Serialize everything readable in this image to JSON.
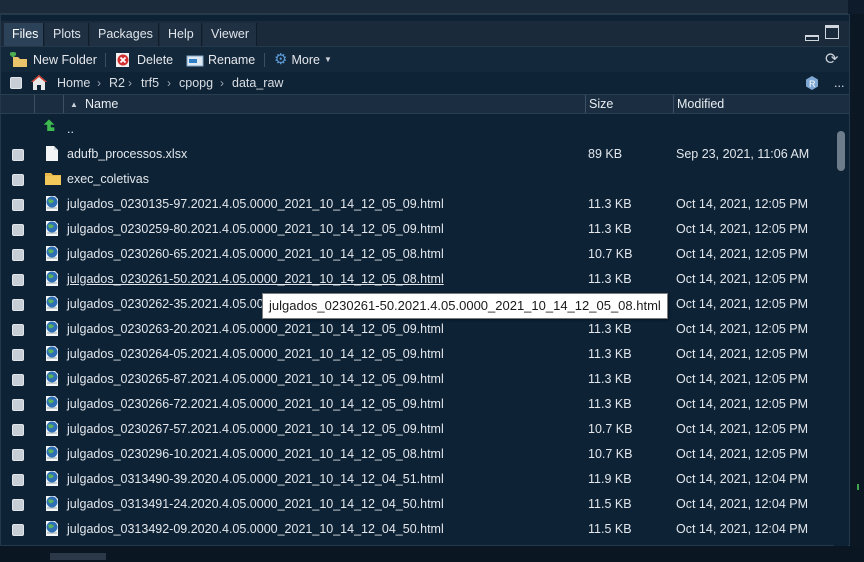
{
  "tabs": [
    {
      "label": "Files",
      "active": true
    },
    {
      "label": "Plots",
      "active": false
    },
    {
      "label": "Packages",
      "active": false
    },
    {
      "label": "Help",
      "active": false
    },
    {
      "label": "Viewer",
      "active": false
    }
  ],
  "toolbar": {
    "new_folder": "New Folder",
    "delete": "Delete",
    "rename": "Rename",
    "more": "More"
  },
  "breadcrumb": [
    "Home",
    "R2",
    "trf5",
    "cpopg",
    "data_raw"
  ],
  "breadcrumb_more": "...",
  "columns": {
    "name": "Name",
    "size": "Size",
    "modified": "Modified"
  },
  "up_label": "..",
  "files": [
    {
      "type": "file",
      "name": "adufb_processos.xlsx",
      "size": "89 KB",
      "modified": "Sep 23, 2021, 11:06 AM"
    },
    {
      "type": "folder",
      "name": "exec_coletivas",
      "size": "",
      "modified": ""
    },
    {
      "type": "html",
      "name": "julgados_0230135-97.2021.4.05.0000_2021_10_14_12_05_09.html",
      "size": "11.3 KB",
      "modified": "Oct 14, 2021, 12:05 PM"
    },
    {
      "type": "html",
      "name": "julgados_0230259-80.2021.4.05.0000_2021_10_14_12_05_09.html",
      "size": "11.3 KB",
      "modified": "Oct 14, 2021, 12:05 PM"
    },
    {
      "type": "html",
      "name": "julgados_0230260-65.2021.4.05.0000_2021_10_14_12_05_08.html",
      "size": "10.7 KB",
      "modified": "Oct 14, 2021, 12:05 PM"
    },
    {
      "type": "html",
      "name": "julgados_0230261-50.2021.4.05.0000_2021_10_14_12_05_08.html",
      "size": "11.3 KB",
      "modified": "Oct 14, 2021, 12:05 PM",
      "hover": true
    },
    {
      "type": "html",
      "name": "julgados_0230262-35.2021.4.05.0000_2021_10_14_12_05_09.html",
      "size": "",
      "modified": "Oct 14, 2021, 12:05 PM"
    },
    {
      "type": "html",
      "name": "julgados_0230263-20.2021.4.05.0000_2021_10_14_12_05_09.html",
      "size": "11.3 KB",
      "modified": "Oct 14, 2021, 12:05 PM"
    },
    {
      "type": "html",
      "name": "julgados_0230264-05.2021.4.05.0000_2021_10_14_12_05_09.html",
      "size": "11.3 KB",
      "modified": "Oct 14, 2021, 12:05 PM"
    },
    {
      "type": "html",
      "name": "julgados_0230265-87.2021.4.05.0000_2021_10_14_12_05_09.html",
      "size": "11.3 KB",
      "modified": "Oct 14, 2021, 12:05 PM"
    },
    {
      "type": "html",
      "name": "julgados_0230266-72.2021.4.05.0000_2021_10_14_12_05_09.html",
      "size": "11.3 KB",
      "modified": "Oct 14, 2021, 12:05 PM"
    },
    {
      "type": "html",
      "name": "julgados_0230267-57.2021.4.05.0000_2021_10_14_12_05_09.html",
      "size": "10.7 KB",
      "modified": "Oct 14, 2021, 12:05 PM"
    },
    {
      "type": "html",
      "name": "julgados_0230296-10.2021.4.05.0000_2021_10_14_12_05_08.html",
      "size": "10.7 KB",
      "modified": "Oct 14, 2021, 12:05 PM"
    },
    {
      "type": "html",
      "name": "julgados_0313490-39.2020.4.05.0000_2021_10_14_12_04_51.html",
      "size": "11.9 KB",
      "modified": "Oct 14, 2021, 12:04 PM"
    },
    {
      "type": "html",
      "name": "julgados_0313491-24.2020.4.05.0000_2021_10_14_12_04_50.html",
      "size": "11.5 KB",
      "modified": "Oct 14, 2021, 12:04 PM"
    },
    {
      "type": "html",
      "name": "julgados_0313492-09.2020.4.05.0000_2021_10_14_12_04_50.html",
      "size": "11.5 KB",
      "modified": "Oct 14, 2021, 12:04 PM"
    }
  ],
  "tooltip": "julgados_0230261-50.2021.4.05.0000_2021_10_14_12_05_08.html"
}
